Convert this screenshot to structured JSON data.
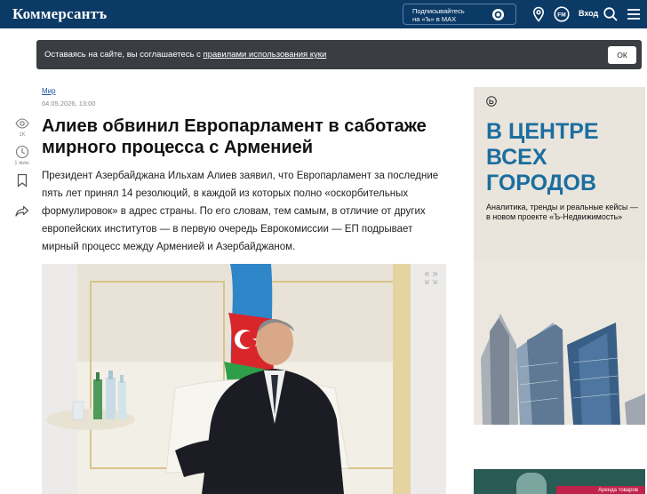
{
  "header": {
    "logo": "Коммерсантъ",
    "max_button_line1": "Подписывайтесь",
    "max_button_line2": "на «Ъ» в MAX",
    "login_label": "Вход",
    "icons": [
      "max-chat-icon",
      "location-pin-icon",
      "radio-fm-icon",
      "search-icon",
      "menu-icon"
    ]
  },
  "cookie": {
    "text_before": "Оставаясь на сайте, вы соглашаетесь с ",
    "link_text": "правилами использования куки",
    "ok_label": "ОК"
  },
  "rail": {
    "views_count": "1K",
    "read_time": "1 мин.",
    "icons": [
      "eye-icon",
      "clock-icon",
      "bookmark-icon",
      "share-icon"
    ]
  },
  "article": {
    "rubric": "Мир",
    "date": "04.05.2026, 13:00",
    "title": "Алиев обвинил Европарламент в саботаже мирного процесса с Арменией",
    "lead": "Президент Азербайджана Ильхам Алиев заявил, что Европарламент за последние пять лет принял 14 резолюций, в каждой из которых полно «оскорбительных формулировок» в адрес страны. По его словам, тем самым, в отличие от других европейских институтов — в первую очередь Еврокомиссии — ЕП подрывает мирный процесс между Арменией и Азербайджаном."
  },
  "ad": {
    "title": "В ЦЕНТРЕ ВСЕХ ГОРОДОВ",
    "subtitle": "Аналитика, тренды и реальные кейсы — в новом проекте «Ъ-Недвижимость»",
    "title_color": "#1b6e9f"
  },
  "ad2": {
    "text": "Аренда товаров"
  },
  "colors": {
    "header_bg": "#0b3a66",
    "cookie_bg": "#3a3d42",
    "link": "#1a56a8"
  }
}
